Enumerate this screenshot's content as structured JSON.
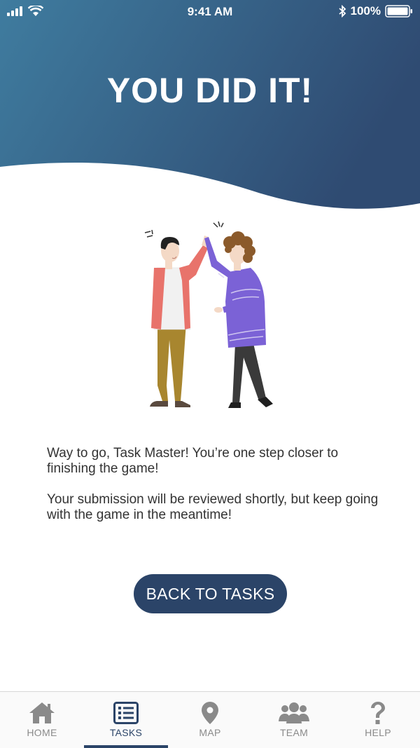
{
  "status_bar": {
    "time": "9:41 AM",
    "battery_percent": "100%",
    "signal_icon": "cellular-signal-icon",
    "wifi_icon": "wifi-icon",
    "bluetooth_icon": "bluetooth-icon",
    "battery_icon": "battery-icon"
  },
  "header": {
    "title": "YOU DID IT!",
    "gradient": [
      "#3f7a9f",
      "#2f4d73"
    ]
  },
  "illustration": {
    "name": "high-five-illustration"
  },
  "message": {
    "line1": "Way to go, Task Master! You’re one step closer to finishing the game!",
    "line2": "Your submission will be reviewed shortly, but keep going with the game in the meantime!"
  },
  "actions": {
    "back_label": "BACK TO TASKS"
  },
  "tabbar": {
    "tabs": [
      {
        "label": "HOME",
        "icon": "home-icon",
        "active": false
      },
      {
        "label": "TASKS",
        "icon": "tasks-list-icon",
        "active": true
      },
      {
        "label": "MAP",
        "icon": "map-pin-icon",
        "active": false
      },
      {
        "label": "TEAM",
        "icon": "team-icon",
        "active": false
      },
      {
        "label": "HELP",
        "icon": "help-question-icon",
        "active": false
      }
    ]
  },
  "colors": {
    "primary": "#2b4468",
    "inactive": "#8a8a8a"
  }
}
